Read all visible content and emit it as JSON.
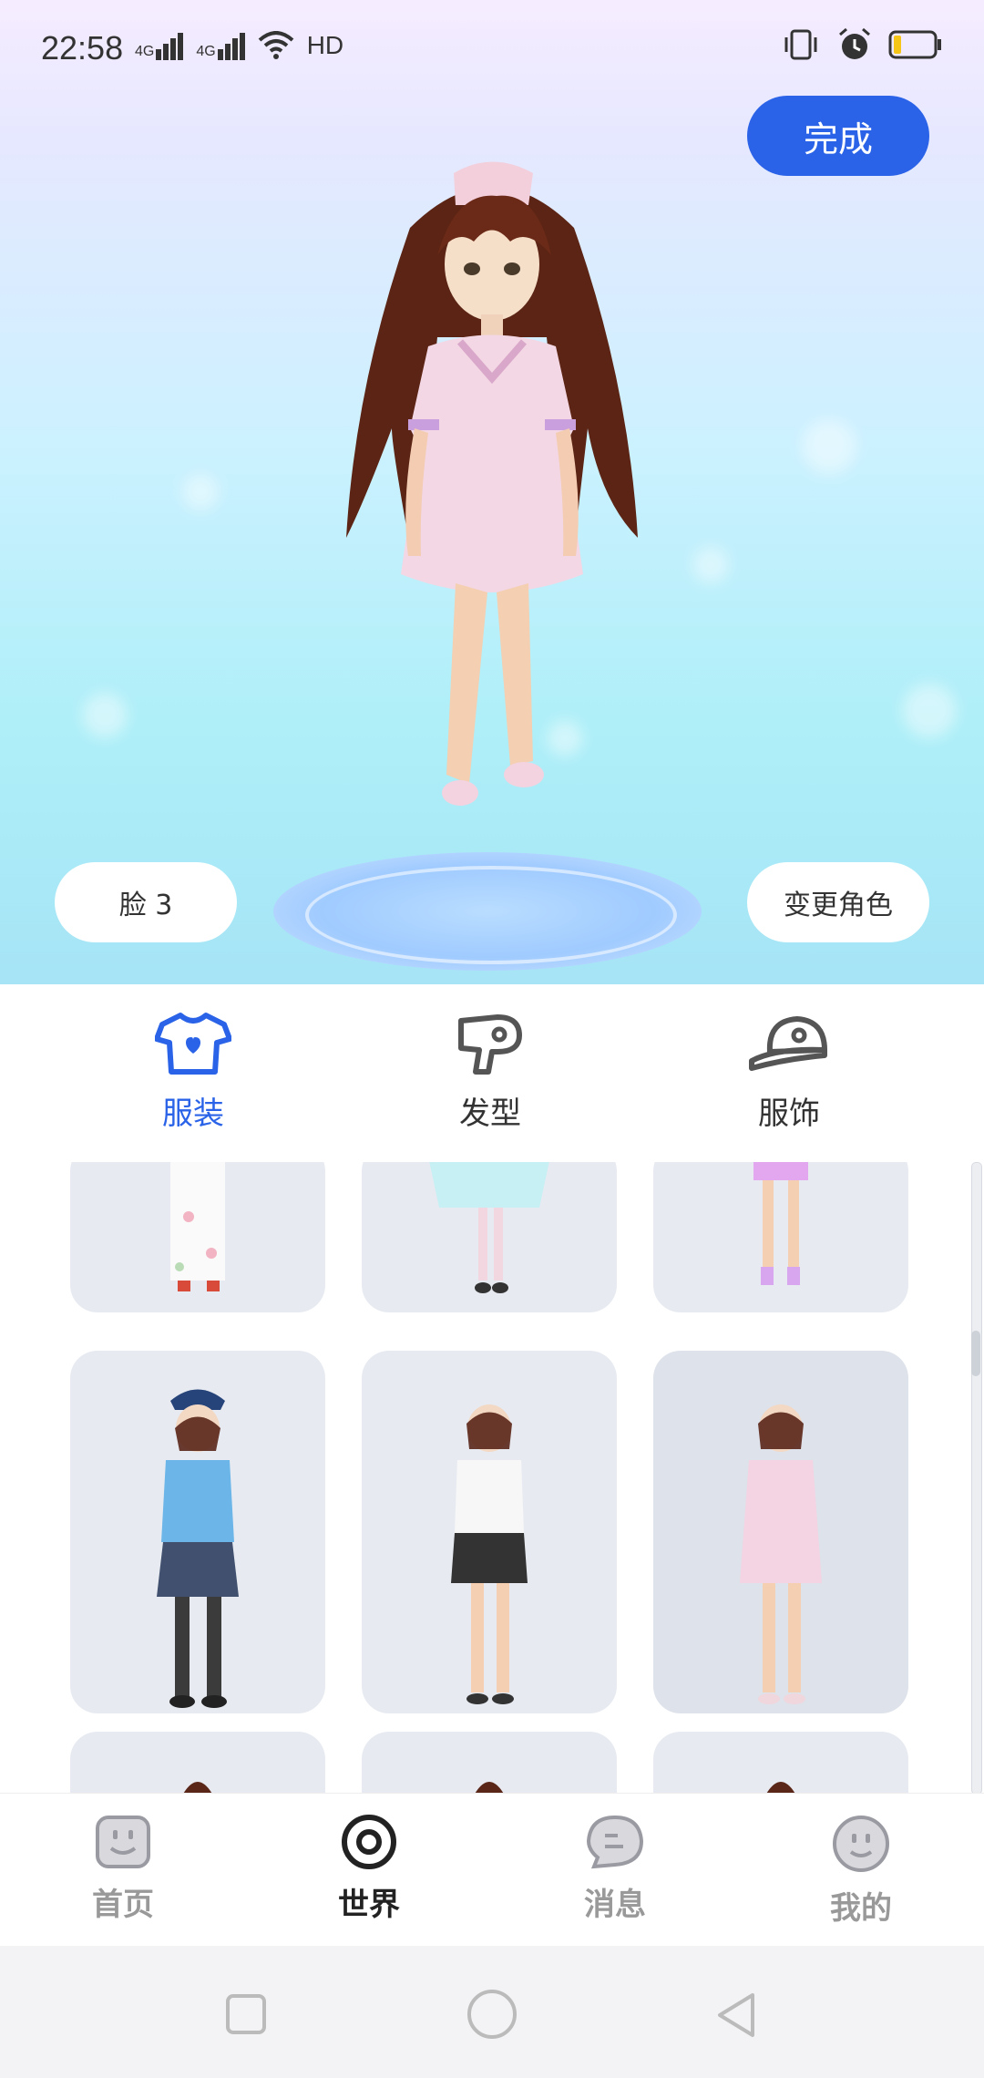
{
  "status_bar": {
    "time": "22:58",
    "signal_1": "4G",
    "signal_2": "4G",
    "hd_label": "HD"
  },
  "header": {
    "done_label": "完成"
  },
  "stage": {
    "face_label": "脸 3",
    "change_role_label": "变更角色"
  },
  "category_tabs": [
    {
      "label": "服装",
      "icon": "tshirt-icon",
      "active": true
    },
    {
      "label": "发型",
      "icon": "hairdryer-icon",
      "active": false
    },
    {
      "label": "服饰",
      "icon": "cap-icon",
      "active": false
    }
  ],
  "bottom_nav": [
    {
      "label": "首页",
      "icon": "home-face-icon",
      "active": false
    },
    {
      "label": "世界",
      "icon": "world-ring-icon",
      "active": true
    },
    {
      "label": "消息",
      "icon": "message-bubble-icon",
      "active": false
    },
    {
      "label": "我的",
      "icon": "profile-face-icon",
      "active": false
    }
  ],
  "colors": {
    "accent": "#2a63e8",
    "tab_active": "#2a63e8",
    "tab_inactive": "#555555",
    "card_bg": "#e7ebf1"
  }
}
